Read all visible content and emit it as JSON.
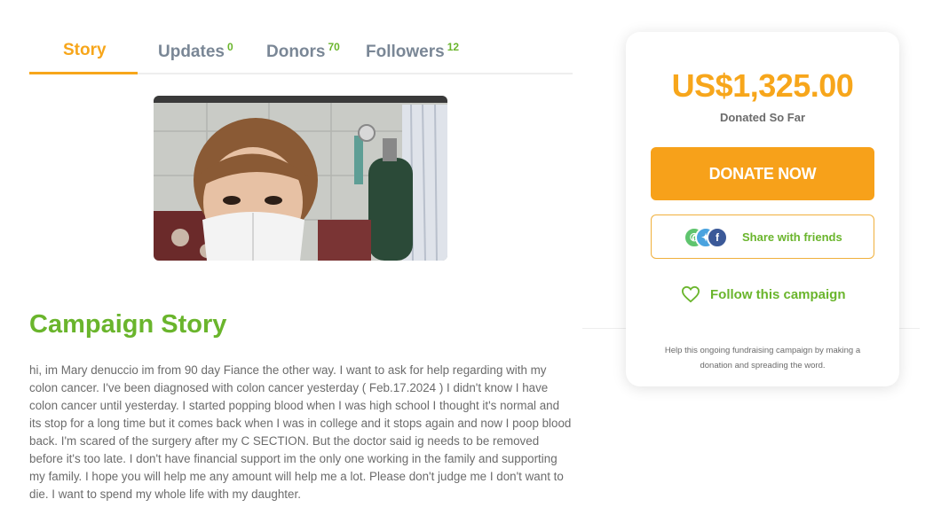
{
  "tabs": [
    {
      "label": "Story",
      "count": ""
    },
    {
      "label": "Updates",
      "count": "0"
    },
    {
      "label": "Donors",
      "count": "70"
    },
    {
      "label": "Followers",
      "count": "12"
    }
  ],
  "campaign": {
    "title": "Campaign Story",
    "body": "hi, im Mary denuccio im from 90 day Fiance the other way. I want to ask for help regarding with my colon cancer. I've been diagnosed with colon cancer yesterday ( Feb.17.2024 ) I didn't know I have colon cancer until yesterday. I started popping blood when I was high school I thought it's normal and its stop for a long time but it comes back when I was in college and it stops again and now I poop blood back. I'm scared of the surgery after my C SECTION. But the doctor said ig needs to be removed before it's too late. I don't have financial support im the only one working in the family and supporting my family. I hope you will help me any amount will help me a lot. Please don't judge me I don't want to die. I want to spend my whole life with my daughter."
  },
  "card": {
    "amount": "US$1,325.00",
    "amount_label": "Donated So Far",
    "donate_label": "DONATE NOW",
    "share_label": "Share with friends",
    "share_icons": [
      "whatsapp-icon",
      "twitter-icon",
      "facebook-icon"
    ],
    "follow_label": "Follow this campaign",
    "help_text": "Help this ongoing fundraising campaign by making a donation and spreading the word."
  },
  "colors": {
    "accent_orange": "#f7a61b",
    "accent_green": "#6ab52c",
    "text_gray": "#6b6b6b",
    "tab_gray": "#7a8796"
  }
}
